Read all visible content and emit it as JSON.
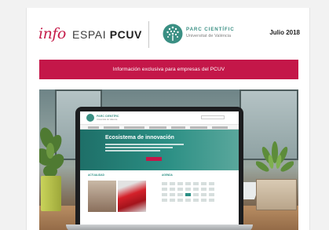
{
  "header": {
    "logo_info": "info",
    "logo_espai": "ESPAI",
    "logo_pcuv": "PCUV",
    "parc_title": "PARC CIENTÍFIC",
    "parc_subtitle": "Universitat de València",
    "date": "Julio 2018"
  },
  "banner": {
    "text": "Información exclusiva para empresas del PCUV"
  },
  "hero": {
    "screen_title": "Ecosistema de innovación",
    "screen_section_news": "ACTUALIDAD",
    "screen_section_agenda": "AGENDA"
  },
  "colors": {
    "brand_crimson": "#c41749",
    "parc_teal": "#3a8f83"
  },
  "icons": {
    "parc_logo": "parc-cientific-tree-icon"
  }
}
